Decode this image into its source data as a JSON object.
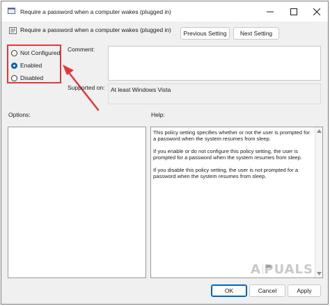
{
  "window": {
    "title": "Require a password when a computer wakes (plugged in)",
    "minimize_icon": "minimize-icon",
    "maximize_icon": "maximize-icon",
    "close_icon": "close-icon"
  },
  "header": {
    "policy_name": "Require a password when a computer wakes (plugged in)",
    "previous_label": "Previous Setting",
    "next_label": "Next Setting"
  },
  "state": {
    "options": [
      {
        "label": "Not Configured",
        "checked": false
      },
      {
        "label": "Enabled",
        "checked": true
      },
      {
        "label": "Disabled",
        "checked": false
      }
    ]
  },
  "comment": {
    "label": "Comment:",
    "value": ""
  },
  "supported": {
    "label": "Supported on:",
    "value": "At least Windows Vista"
  },
  "options_panel": {
    "label": "Options:"
  },
  "help_panel": {
    "label": "Help:",
    "paragraphs": [
      "This policy setting specifies whether or not the user is prompted for a password when the system resumes from sleep.",
      "If you enable or do not configure this policy setting, the user is prompted for a password when the system resumes from sleep.",
      "If you disable this policy setting, the user is not prompted for a password when the system resumes from sleep."
    ]
  },
  "footer": {
    "ok_label": "OK",
    "cancel_label": "Cancel",
    "apply_label": "Apply"
  },
  "watermark": {
    "text": "APPUALS"
  },
  "colors": {
    "highlight": "#e0393b",
    "accent": "#0063b1"
  }
}
